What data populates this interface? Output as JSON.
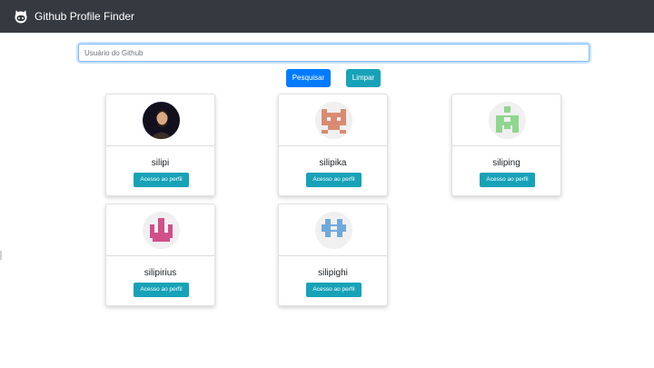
{
  "navbar": {
    "title": "Github Profile Finder",
    "logo_icon": "github-octocat-icon"
  },
  "search": {
    "placeholder": "Usuário do Github",
    "value": ""
  },
  "buttons": {
    "search_label": "Pesquisar",
    "clear_label": "Limpar"
  },
  "colors": {
    "navbar": "#343a40",
    "primary": "#007bff",
    "info": "#17a2b8"
  },
  "profiles": [
    {
      "name": "silipi",
      "action": "Acesso ao perfil"
    },
    {
      "name": "silipika",
      "action": "Acesso ao perfil"
    },
    {
      "name": "siliping",
      "action": "Acesso ao perfil"
    },
    {
      "name": "silipirius",
      "action": "Acesso ao perfil"
    },
    {
      "name": "silipighi",
      "action": "Acesso ao perfil"
    }
  ]
}
